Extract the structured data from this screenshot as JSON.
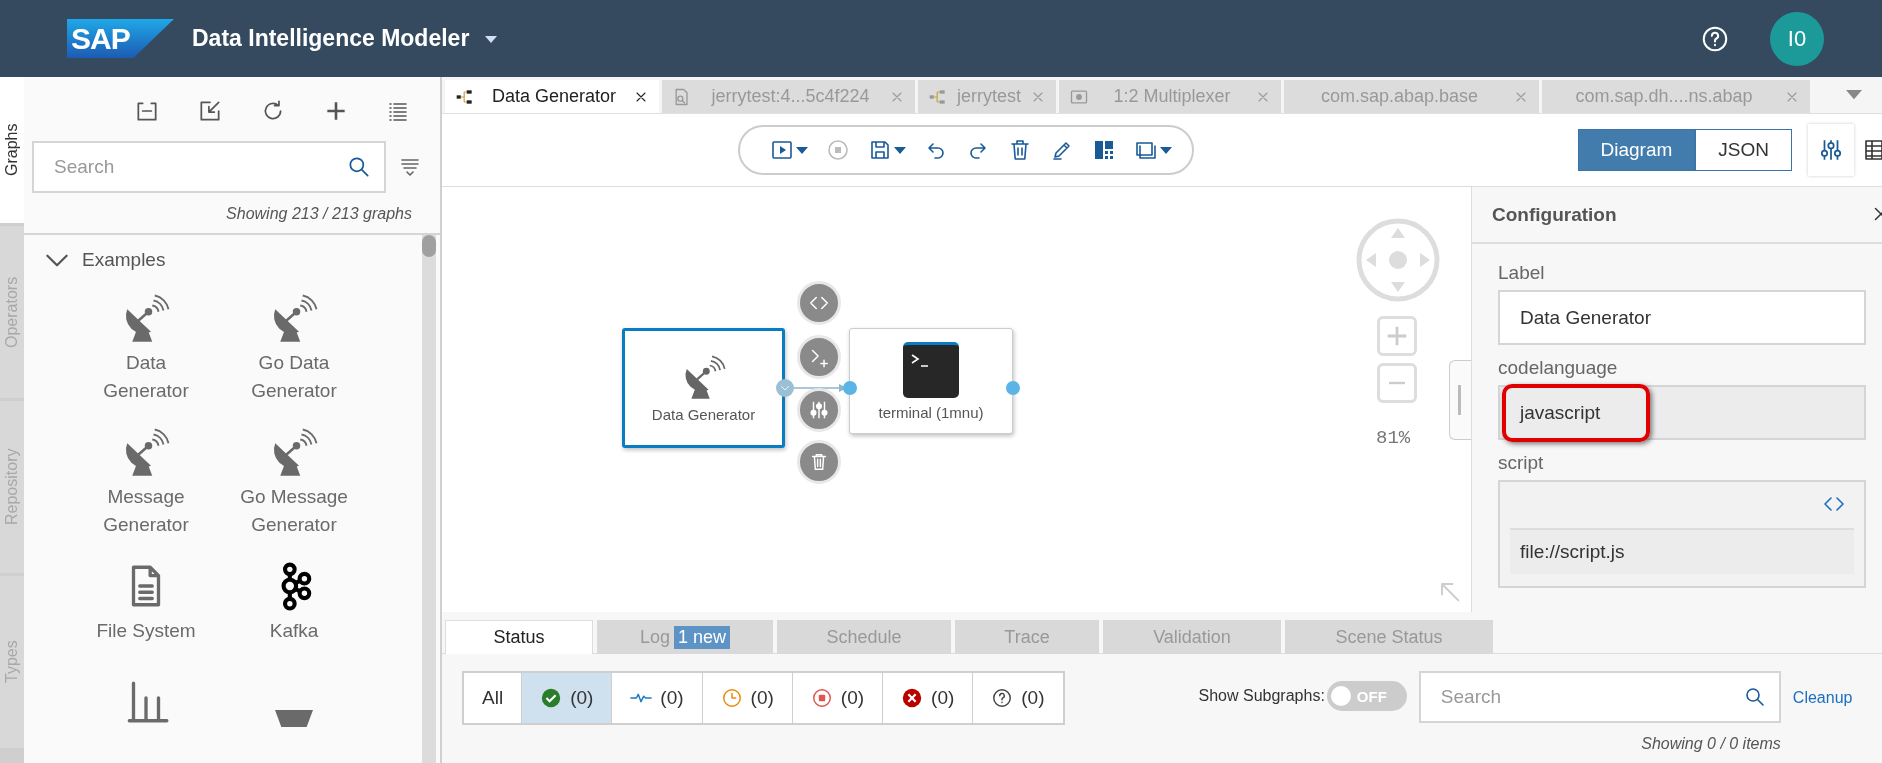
{
  "header": {
    "logo": "SAP",
    "title": "Data Intelligence Modeler",
    "avatar": "I0"
  },
  "side_tabs": [
    {
      "label": "Graphs",
      "selected": true
    },
    {
      "label": "Operators",
      "selected": false
    },
    {
      "label": "Repository",
      "selected": false
    },
    {
      "label": "Types",
      "selected": false
    }
  ],
  "graphs_panel": {
    "search": {
      "placeholder": "Search"
    },
    "count": "Showing 213 / 213 graphs",
    "group": {
      "label": "Examples",
      "expanded": true,
      "items": [
        {
          "label": "Data Generator",
          "kind": "dish"
        },
        {
          "label": "Go Data Generator",
          "kind": "dish"
        },
        {
          "label": "Message Generator",
          "kind": "dish"
        },
        {
          "label": "Go Message Generator",
          "kind": "dish"
        },
        {
          "label": "File System",
          "kind": "file"
        },
        {
          "label": "Kafka",
          "kind": "kafka"
        },
        {
          "kind": "chart"
        },
        {
          "kind": "funnel"
        }
      ]
    }
  },
  "doc_tabs": [
    {
      "label": "Data Generator",
      "kind": "graph",
      "selected": true
    },
    {
      "label": "jerrytest:4...5c4f224",
      "kind": "trace",
      "selected": false
    },
    {
      "label": "jerrytest",
      "kind": "graph",
      "selected": false
    },
    {
      "label": "1:2 Multiplexer",
      "kind": "operator",
      "selected": false
    },
    {
      "label": "com.sap.abap.base",
      "kind": "package",
      "selected": false
    },
    {
      "label": "com.sap.dh....ns.abap",
      "kind": "package",
      "selected": false
    }
  ],
  "toolbar": [
    {
      "kind": "run",
      "caret": true,
      "disabled": false
    },
    {
      "kind": "stop",
      "caret": false,
      "disabled": true
    },
    {
      "kind": "save",
      "caret": true,
      "disabled": false
    },
    {
      "kind": "undo",
      "caret": false,
      "disabled": false
    },
    {
      "kind": "redo",
      "caret": false,
      "disabled": false
    },
    {
      "kind": "delete",
      "caret": false,
      "disabled": false
    },
    {
      "kind": "edit",
      "caret": false,
      "disabled": false
    },
    {
      "kind": "layout",
      "caret": false,
      "disabled": false
    },
    {
      "kind": "view",
      "caret": true,
      "disabled": false
    }
  ],
  "view_switch": [
    {
      "label": "Diagram",
      "selected": true
    },
    {
      "label": "JSON",
      "selected": false
    }
  ],
  "canvas": {
    "nodes": [
      {
        "label": "Data Generator",
        "kind": "dish",
        "selected": true
      },
      {
        "label": "terminal (1mnu)",
        "kind": "terminal",
        "selected": false
      }
    ],
    "zoom": "81%"
  },
  "config": {
    "title": "Configuration",
    "fields": [
      {
        "label": "Label",
        "value": "Data Generator",
        "kind": "input",
        "highlighted": false
      },
      {
        "label": "codelanguage",
        "value": "javascript",
        "kind": "readonly",
        "highlighted": true
      },
      {
        "label": "script",
        "value": "file://script.js",
        "kind": "script",
        "highlighted": false
      }
    ]
  },
  "bottom": {
    "tabs": [
      {
        "label": "Status",
        "selected": true
      },
      {
        "label": "Log",
        "badge": "1 new",
        "selected": false
      },
      {
        "label": "Schedule",
        "selected": false
      },
      {
        "label": "Trace",
        "selected": false
      },
      {
        "label": "Validation",
        "selected": false
      },
      {
        "label": "Scene Status",
        "selected": false
      }
    ],
    "filters": [
      {
        "kind": "all",
        "label": "All",
        "selected": false
      },
      {
        "kind": "success",
        "label": "(0)",
        "selected": true
      },
      {
        "kind": "running",
        "label": "(0)",
        "selected": false
      },
      {
        "kind": "pending",
        "label": "(0)",
        "selected": false
      },
      {
        "kind": "stopped",
        "label": "(0)",
        "selected": false
      },
      {
        "kind": "failed",
        "label": "(0)",
        "selected": false
      },
      {
        "kind": "unknown",
        "label": "(0)",
        "selected": false
      }
    ],
    "subgraphs": {
      "label": "Show Subgraphs:",
      "on": false,
      "state_text": "OFF"
    },
    "search": {
      "placeholder": "Search"
    },
    "link": "Cleanup",
    "count": "Showing 0 / 0 items"
  }
}
